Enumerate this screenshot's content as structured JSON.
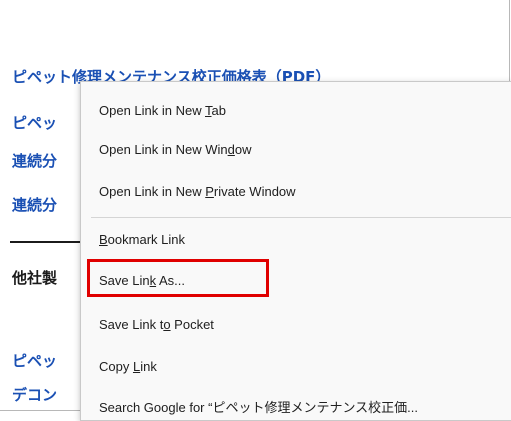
{
  "page": {
    "links": [
      {
        "text": "ピペット修理メンテナンス校正価格表（PDF）"
      },
      {
        "text": "ピペッ"
      },
      {
        "text": "連続分"
      },
      {
        "text": "連続分"
      }
    ],
    "section_heading": "他社製",
    "bottom_links": [
      {
        "text": "ピペッ"
      },
      {
        "text": "デコン"
      }
    ]
  },
  "context_menu": {
    "items": [
      {
        "pre": "Open Link in New ",
        "key": "T",
        "post": "ab"
      },
      {
        "pre": "Open Link in New Win",
        "key": "d",
        "post": "ow"
      },
      {
        "pre": "Open Link in New ",
        "key": "P",
        "post": "rivate Window"
      },
      {
        "pre": "",
        "key": "B",
        "post": "ookmark Link"
      },
      {
        "pre": "Save Lin",
        "key": "k",
        "post": " As..."
      },
      {
        "pre": "Save Link t",
        "key": "o",
        "post": " Pocket"
      },
      {
        "pre": "Copy ",
        "key": "L",
        "post": "ink"
      },
      {
        "pre": "Search Google for “ピペット修理メンテナンス校正価...",
        "key": "",
        "post": ""
      }
    ]
  },
  "colors": {
    "link": "#1a50b4",
    "highlight_border": "#e00000",
    "menu_bg": "#f9f9f9"
  }
}
